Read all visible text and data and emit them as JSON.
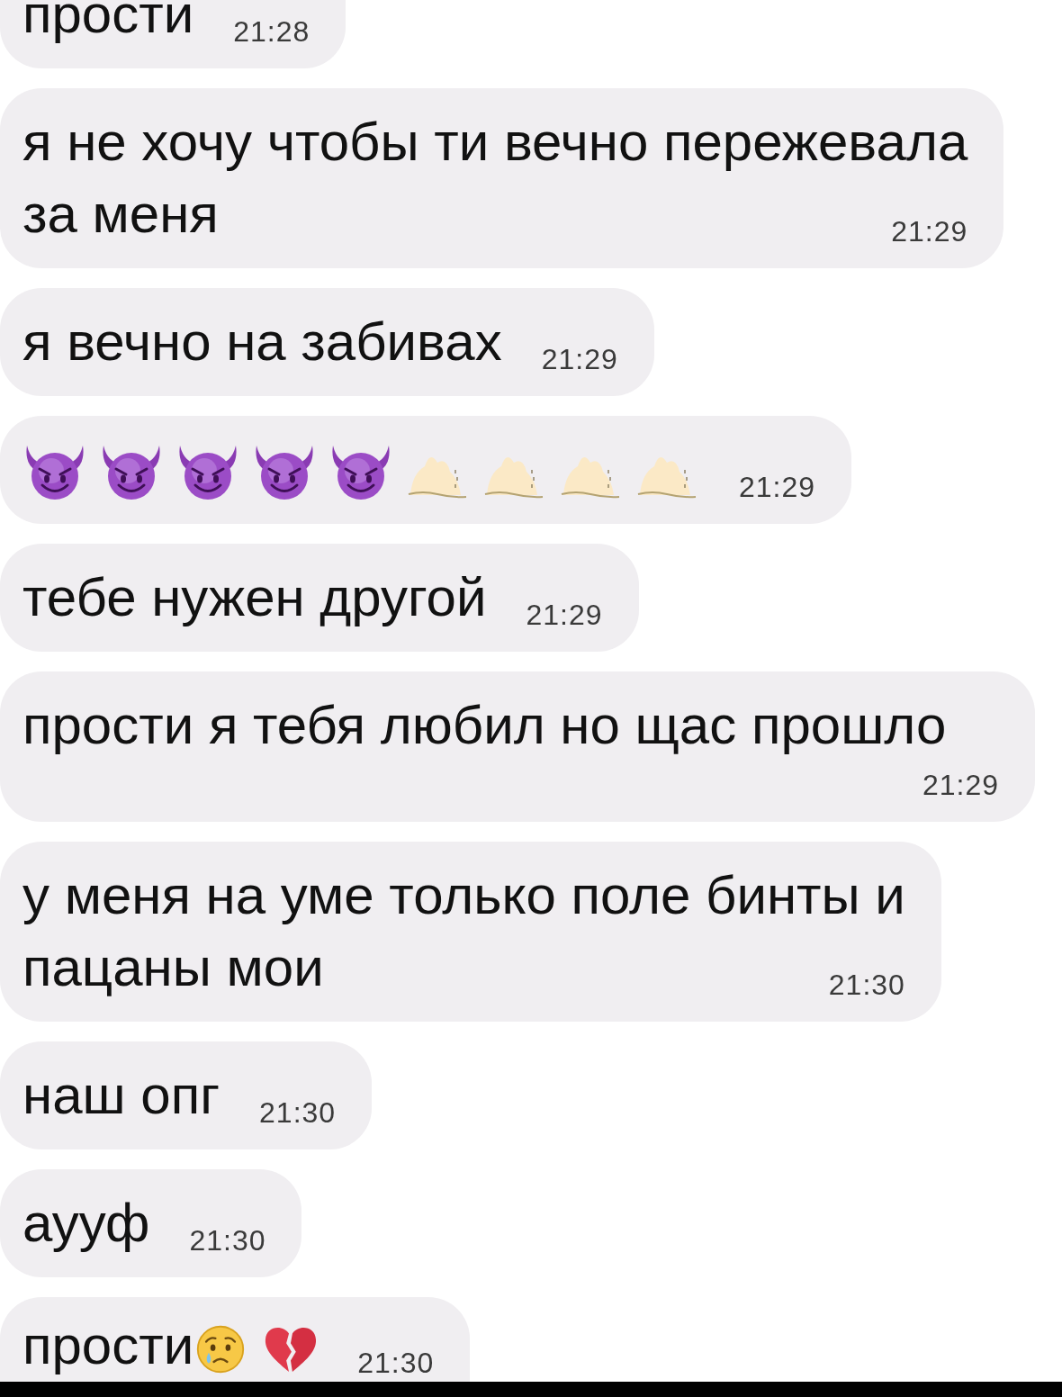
{
  "messages": [
    {
      "lines": [
        "прости"
      ],
      "time": "21:28"
    },
    {
      "lines": [
        "я не хочу чтобы ти вечно пережевала",
        "за меня"
      ],
      "time": "21:29"
    },
    {
      "lines": [
        "я вечно на забивах"
      ],
      "time": "21:29"
    },
    {
      "emojis": [
        {
          "kind": "devil"
        },
        {
          "kind": "devil"
        },
        {
          "kind": "devil"
        },
        {
          "kind": "devil"
        },
        {
          "kind": "devil"
        },
        {
          "kind": "faded"
        },
        {
          "kind": "faded"
        },
        {
          "kind": "faded"
        },
        {
          "kind": "faded"
        }
      ],
      "time": "21:29"
    },
    {
      "lines": [
        "тебе нужен другой"
      ],
      "time": "21:29"
    },
    {
      "lines": [
        "прости я тебя любил но щас прошло"
      ],
      "time": "21:29"
    },
    {
      "lines": [
        "у меня на уме только поле бинты и",
        "пацаны мои"
      ],
      "time": "21:30"
    },
    {
      "lines": [
        "наш опг"
      ],
      "time": "21:30"
    },
    {
      "lines": [
        "аууф"
      ],
      "time": "21:30"
    },
    {
      "lines": [
        "прости"
      ],
      "emojis": [
        {
          "kind": "crying_face"
        },
        {
          "kind": "broken_heart"
        }
      ],
      "time": "21:30"
    }
  ]
}
